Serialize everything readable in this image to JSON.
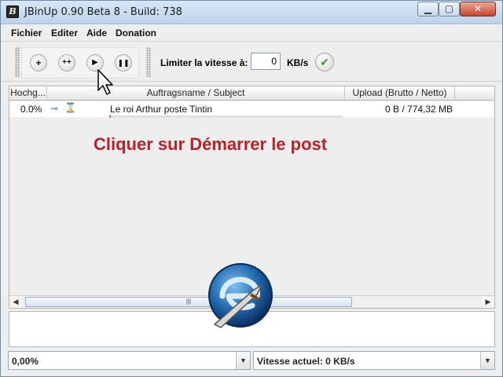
{
  "window": {
    "title": "JBinUp 0.90 Beta 8 - Build: 738",
    "app_icon_letter": "B",
    "minimize_glyph": "▁",
    "maximize_glyph": "▢",
    "close_glyph": "✕"
  },
  "menu": {
    "items": [
      "Fichier",
      "Editer",
      "Aide",
      "Donation"
    ]
  },
  "toolbar": {
    "add_label": "+",
    "add_multi_label": "++",
    "start_label": "▶",
    "pause_label": "❚❚",
    "speed_limit_label": "Limiter la vitesse à:",
    "speed_limit_value": "0",
    "speed_unit": "KB/s",
    "apply_glyph": "✔"
  },
  "table": {
    "columns": [
      "Hochg...",
      "Auftragsname / Subject",
      "Upload (Brutto / Netto)"
    ],
    "rows": [
      {
        "progress": "0.0%",
        "name": "Le roi Arthur poste Tintin",
        "upload": "0 B / 774,32 MB",
        "progress_fraction": 0.0,
        "icons": [
          "key-icon",
          "hourglass-icon"
        ]
      }
    ]
  },
  "annotation": "Cliquer sur Démarrer le post",
  "scrollbar": {
    "left_arrow": "◀",
    "right_arrow": "▶",
    "thumb_grip": "|||"
  },
  "status": {
    "left_value": "0,00%",
    "right_label": "Vitesse actuel:  0 KB/s",
    "dropdown_arrow": "▼"
  },
  "colors": {
    "annotation": "#b8202a",
    "progress": "#39b54a",
    "close_button": "#c7432a"
  }
}
